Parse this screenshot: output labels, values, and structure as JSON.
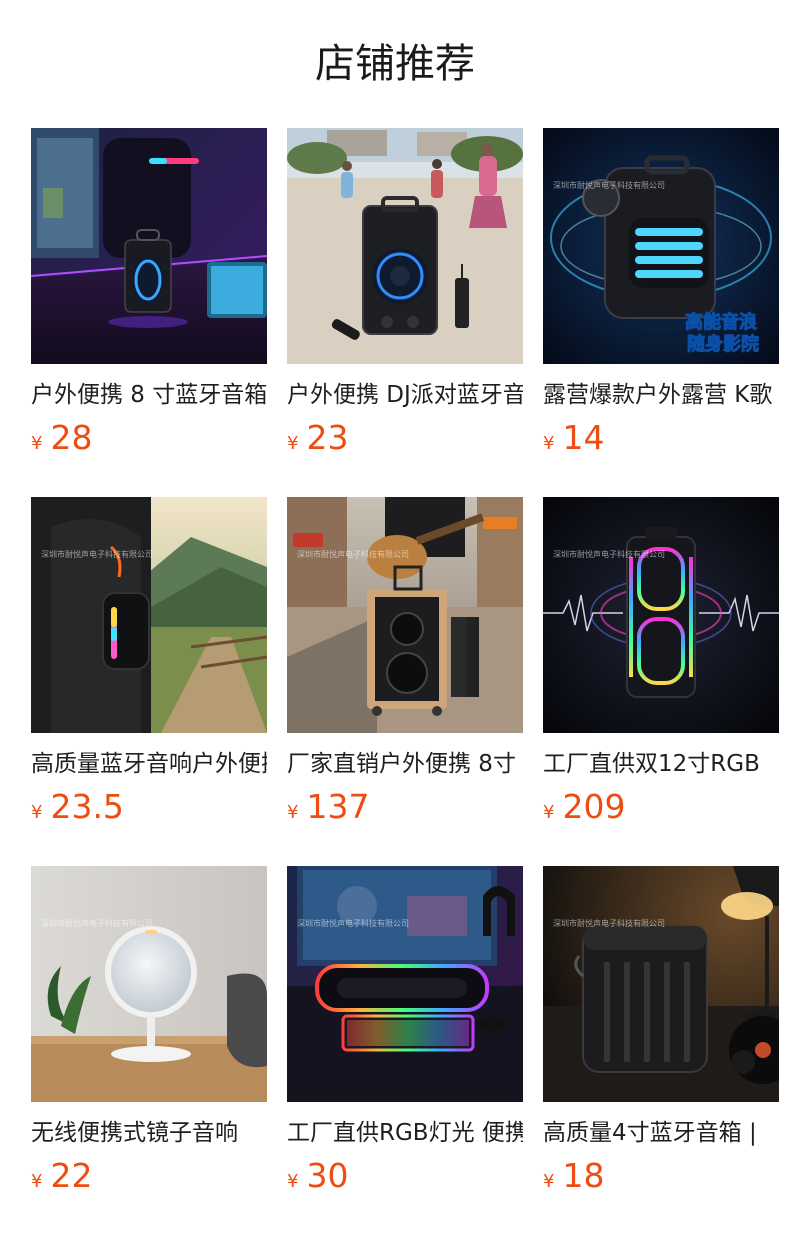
{
  "page": {
    "title": "店铺推荐",
    "currency_symbol": "¥"
  },
  "products": [
    {
      "name": "户外便携 8 寸蓝牙音箱",
      "price": "28",
      "badge": ""
    },
    {
      "name": "户外便携 DJ派对蓝牙音箱",
      "price": "23",
      "badge": ""
    },
    {
      "name": "露营爆款户外露营 K歌",
      "price": "14",
      "badge_line1": "高能音浪",
      "badge_line2": "随身影院"
    },
    {
      "name": "高质量蓝牙音响户外便携",
      "price": "23.5",
      "badge": ""
    },
    {
      "name": "厂家直销户外便携 8寸",
      "price": "137",
      "badge": ""
    },
    {
      "name": "工厂直供双12寸RGB",
      "price": "209",
      "badge": ""
    },
    {
      "name": "无线便携式镜子音响",
      "price": "22",
      "badge": ""
    },
    {
      "name": "工厂直供RGB灯光 便携",
      "price": "30",
      "badge": ""
    },
    {
      "name": "高质量4寸蓝牙音箱 |",
      "price": "18",
      "badge": ""
    }
  ],
  "watermark": "深圳市耐悦声电子科技有限公司",
  "colors": {
    "price": "#ee4d12",
    "title": "#1a1a1a",
    "text": "#1f1f1f"
  }
}
